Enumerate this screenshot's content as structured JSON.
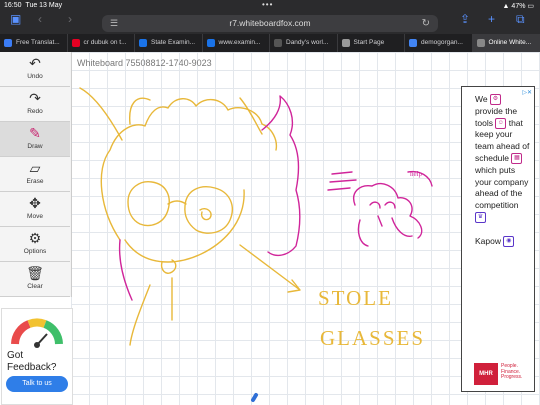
{
  "status_bar": {
    "time": "16:50",
    "date": "Tue 13 May",
    "battery": "47%"
  },
  "address_bar": {
    "url": "r7.whiteboardfox.com"
  },
  "tabs": [
    {
      "label": "Free Translat...",
      "icon_color": "#3b7cf5",
      "active": false
    },
    {
      "label": "cr dubuk on t...",
      "icon_color": "#e60023",
      "active": false
    },
    {
      "label": "State Examin...",
      "icon_color": "#1a73e8",
      "active": false
    },
    {
      "label": "www.examin...",
      "icon_color": "#1a73e8",
      "active": false
    },
    {
      "label": "Dandy's worl...",
      "icon_color": "#555555",
      "active": false
    },
    {
      "label": "Start Page",
      "icon_color": "#999999",
      "active": false
    },
    {
      "label": "demogorgan...",
      "icon_color": "#4285f4",
      "active": false
    },
    {
      "label": "Online White...",
      "icon_color": "#888888",
      "active": true
    }
  ],
  "whiteboard": {
    "id_label": "Whiteboard 75508812-1740-9023"
  },
  "toolbar": {
    "tools": [
      {
        "label": "Undo",
        "icon": "undo-icon",
        "glyph": "↶"
      },
      {
        "label": "Redo",
        "icon": "redo-icon",
        "glyph": "↷"
      },
      {
        "label": "Draw",
        "icon": "pen-icon",
        "glyph": "✎"
      },
      {
        "label": "Erase",
        "icon": "eraser-icon",
        "glyph": "▱"
      },
      {
        "label": "Move",
        "icon": "move-icon",
        "glyph": "✥"
      },
      {
        "label": "Options",
        "icon": "gear-icon",
        "glyph": "⚙"
      },
      {
        "label": "Clear",
        "icon": "trash-icon",
        "glyph": "🗑"
      }
    ]
  },
  "feedback": {
    "text": "Got Feedback?",
    "button": "Talk to us"
  },
  "ad": {
    "w1": "We",
    "w2": "provide the tools",
    "w3": "that keep your team ahead of schedule",
    "w4": "which puts your company ahead of the competition",
    "brand": "Kapow",
    "sponsor_logo": "MHR",
    "sponsor_tagline": "People. Finance. Progress."
  },
  "drawing_text": {
    "handwritten": "STOLE GLASSES",
    "small_note": "help-",
    "ink_colors": {
      "yellow": "#e8b83a",
      "magenta": "#d0259a"
    }
  },
  "colors": {
    "chrome_bg": "#2b2b2d",
    "accent_blue": "#2f7ee8"
  }
}
